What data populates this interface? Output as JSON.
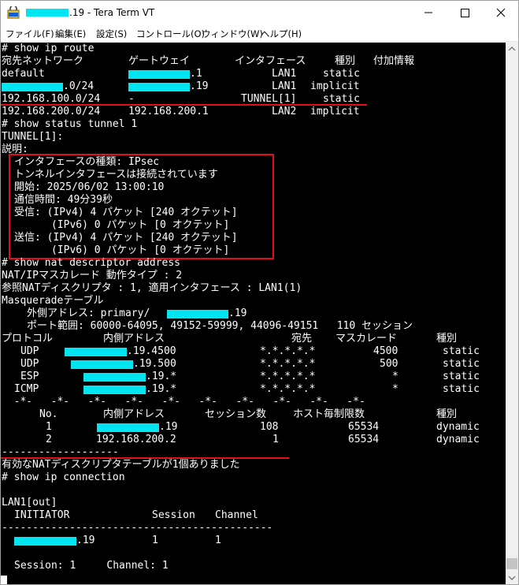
{
  "window": {
    "title": ".19 - Tera Term VT",
    "redact_color": "#00e5f0",
    "highlight_color": "#e0101a"
  },
  "menu": {
    "file": "ファイル(F)",
    "edit": "編集(E)",
    "setup": "設定(S)",
    "control": "コントロール(O)",
    "window": "ウィンドウ(W)",
    "help": "ヘルプ(H)"
  },
  "terminal": {
    "cmd_route": "# show ip route",
    "route_header": {
      "dest": "宛先ネットワーク",
      "gateway": "ゲートウェイ",
      "iface": "インタフェース",
      "kind": "種別",
      "extra": "付加情報"
    },
    "routes": [
      {
        "dest": "default",
        "gateway": ".1",
        "iface": "LAN1",
        "kind": "static"
      },
      {
        "dest": ".0/24",
        "gateway": ".19",
        "iface": "LAN1",
        "kind": "implicit"
      },
      {
        "dest": "192.168.100.0/24",
        "gateway": "-",
        "iface": "TUNNEL[1]",
        "kind": "static"
      },
      {
        "dest": "192.168.200.0/24",
        "gateway": "192.168.200.1",
        "iface": "LAN2",
        "kind": "implicit"
      }
    ],
    "cmd_tunnel": "# show status tunnel 1",
    "tunnel_name": "TUNNEL[1]:",
    "desc_label": "説明:",
    "tunnel_status": [
      "インタフェースの種類: IPsec",
      "トンネルインタフェースは接続されています",
      "開始: 2025/06/02 13:00:10",
      "通信時間: 49分39秒",
      "受信: (IPv4) 4 パケット [240 オクテット]",
      "      (IPv6) 0 パケット [0 オクテット]",
      "送信: (IPv4) 4 パケット [240 オクテット]",
      "      (IPv6) 0 パケット [0 オクテット]"
    ],
    "cmd_nat": "# show nat descriptor address",
    "nat_type": "NAT/IPマスカレード 動作タイプ : 2",
    "nat_ref": "参照NATディスクリプタ : 1, 適用インタフェース : LAN1(1)",
    "masq_table": "Masqueradeテーブル",
    "outer_label": "外側アドレス: primary/",
    "outer_suffix": ".19",
    "port_range": "ポート範囲: 60000-64095, 49152-59999, 44096-49151   110 セッション",
    "proto_header": {
      "proto": "プロトコル",
      "inner": "内側アドレス",
      "dest": "宛先",
      "masq": "マスカレード",
      "kind": "種別"
    },
    "proto_rows": [
      {
        "proto": "UDP",
        "inner": ".19.4500",
        "dest": "*.*.*.*.*",
        "masq": "4500",
        "kind": "static"
      },
      {
        "proto": "UDP",
        "inner": ".19.500",
        "dest": "*.*.*.*.*",
        "masq": "500",
        "kind": "static"
      },
      {
        "proto": "ESP",
        "inner": ".19.*",
        "dest": "*.*.*.*.*",
        "masq": "*",
        "kind": "static"
      },
      {
        "proto": "ICMP",
        "inner": ".19.*",
        "dest": "*.*.*.*.*",
        "masq": "*",
        "kind": "static"
      }
    ],
    "separator": "  -*-   -*-   -*-   -*-   -*-   -*-   -*-   -*-   -*-   -*-",
    "sess_header": {
      "no": "No.",
      "inner": "内側アドレス",
      "sessions": "セッション数",
      "limit": "ホスト毎制限数",
      "kind": "種別"
    },
    "sess_rows": [
      {
        "no": "1",
        "inner": ".19",
        "sessions": "108",
        "limit": "65534",
        "kind": "dynamic"
      },
      {
        "no": "2",
        "inner": "192.168.200.2",
        "sessions": "1",
        "limit": "65534",
        "kind": "dynamic"
      }
    ],
    "dash_short": "-------------------",
    "nat_summary": "有効なNATディスクリプタテーブルが1個ありました",
    "cmd_conn": "# show ip connection",
    "lan_out": "LAN1[out]",
    "conn_header": {
      "initiator": "INITIATOR",
      "session": "Session",
      "channel": "Channel"
    },
    "dash_long": "--------------------------------------------",
    "conn_row": {
      "initiator": ".19",
      "session": "1",
      "channel": "1"
    },
    "conn_summary": "Session: 1     Channel: 1"
  }
}
